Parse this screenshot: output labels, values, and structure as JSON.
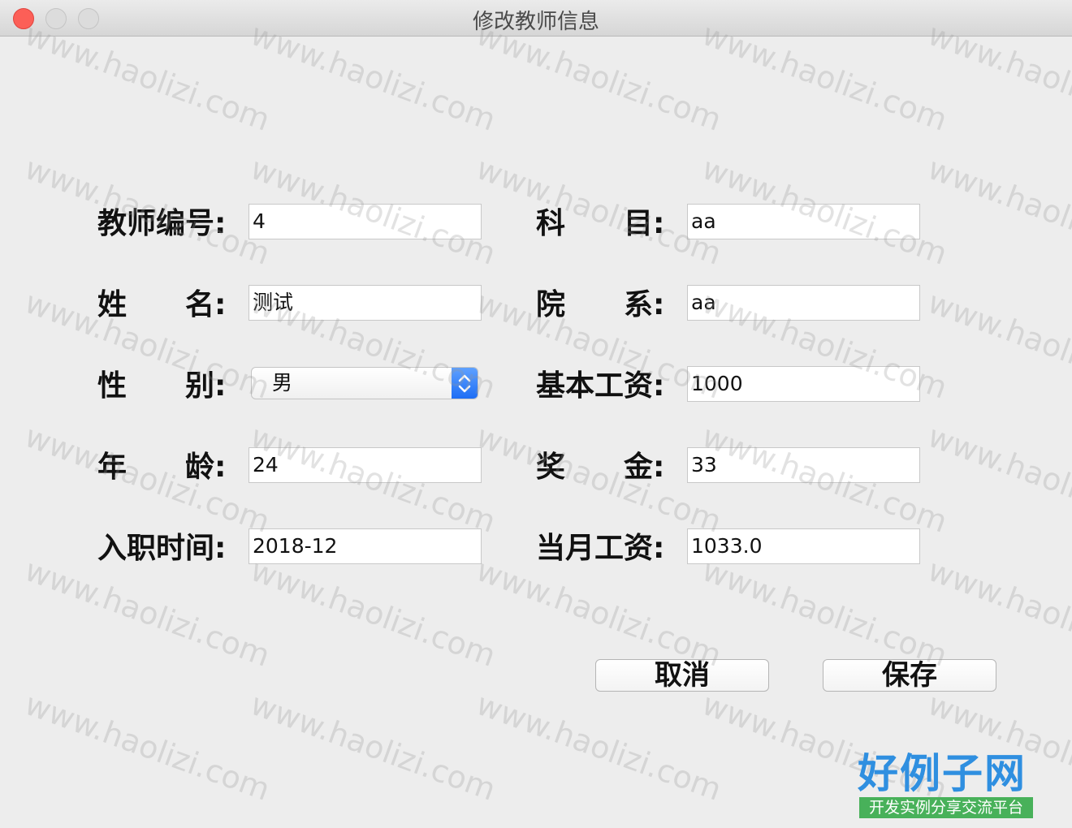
{
  "window": {
    "title": "修改教师信息"
  },
  "form": {
    "teacher_id": {
      "label": "教师编号:",
      "value": "4"
    },
    "name": {
      "label": [
        "姓",
        "名:"
      ],
      "value": "测试"
    },
    "gender": {
      "label": [
        "性",
        "别:"
      ],
      "value": "男"
    },
    "age": {
      "label": [
        "年",
        "龄:"
      ],
      "value": "24"
    },
    "hire_date": {
      "label": "入职时间:",
      "value": "2018-12"
    },
    "subject": {
      "label": [
        "科",
        "目:"
      ],
      "value": "aa"
    },
    "department": {
      "label": [
        "院",
        "系:"
      ],
      "value": "aa"
    },
    "base_salary": {
      "label": "基本工资:",
      "value": "1000"
    },
    "bonus": {
      "label": [
        "奖",
        "金:"
      ],
      "value": "33"
    },
    "monthly_salary": {
      "label": "当月工资:",
      "value": "1033.0"
    }
  },
  "buttons": {
    "cancel": "取消",
    "save": "保存"
  },
  "watermark": "www.haolizi.com",
  "logo": {
    "main": "好例子网",
    "sub": "开发实例分享交流平台"
  },
  "colors": {
    "close": "#fc5f57",
    "select_accent": "#1e6ef5",
    "logo_blue": "#2f8fe0",
    "logo_green": "#48b15a"
  }
}
